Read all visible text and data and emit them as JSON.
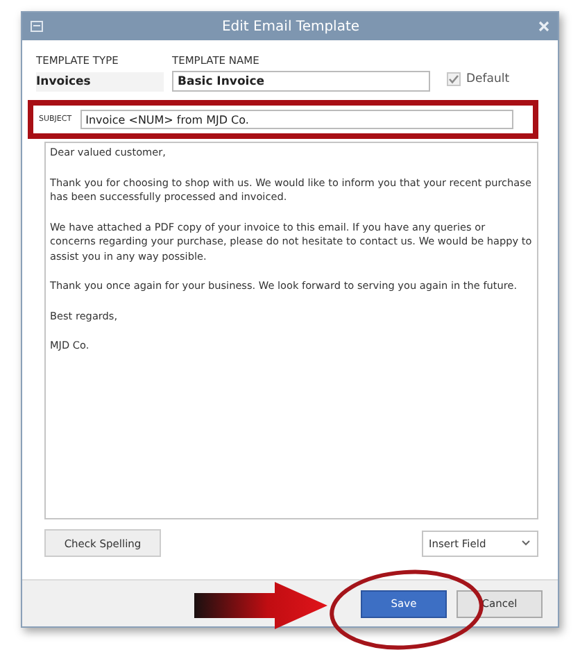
{
  "window": {
    "title": "Edit Email Template"
  },
  "template_type": {
    "label": "TEMPLATE TYPE",
    "value": "Invoices"
  },
  "template_name": {
    "label": "TEMPLATE NAME",
    "value": "Basic Invoice"
  },
  "default_checkbox": {
    "label": "Default",
    "checked": true,
    "disabled": true
  },
  "subject": {
    "label": "SUBJECT",
    "value": "Invoice <NUM> from MJD Co."
  },
  "body": {
    "paragraphs": [
      "Dear valued customer,",
      "Thank you for choosing to shop with us. We would like to inform you that your recent purchase has been successfully processed and invoiced.",
      "We have attached a PDF copy of your invoice to this email. If you have any queries or concerns regarding your purchase, please do not hesitate to contact us. We would be happy to assist you in any way possible.",
      "Thank you once again for your business. We look forward to serving you again in the future.",
      "Best regards,",
      "MJD Co."
    ]
  },
  "check_spelling_button": {
    "label": "Check Spelling"
  },
  "insert_field_dropdown": {
    "label": "Insert Field"
  },
  "buttons": [
    {
      "label": "Save",
      "kind": "primary"
    },
    {
      "label": "Cancel",
      "kind": "secondary"
    }
  ]
}
